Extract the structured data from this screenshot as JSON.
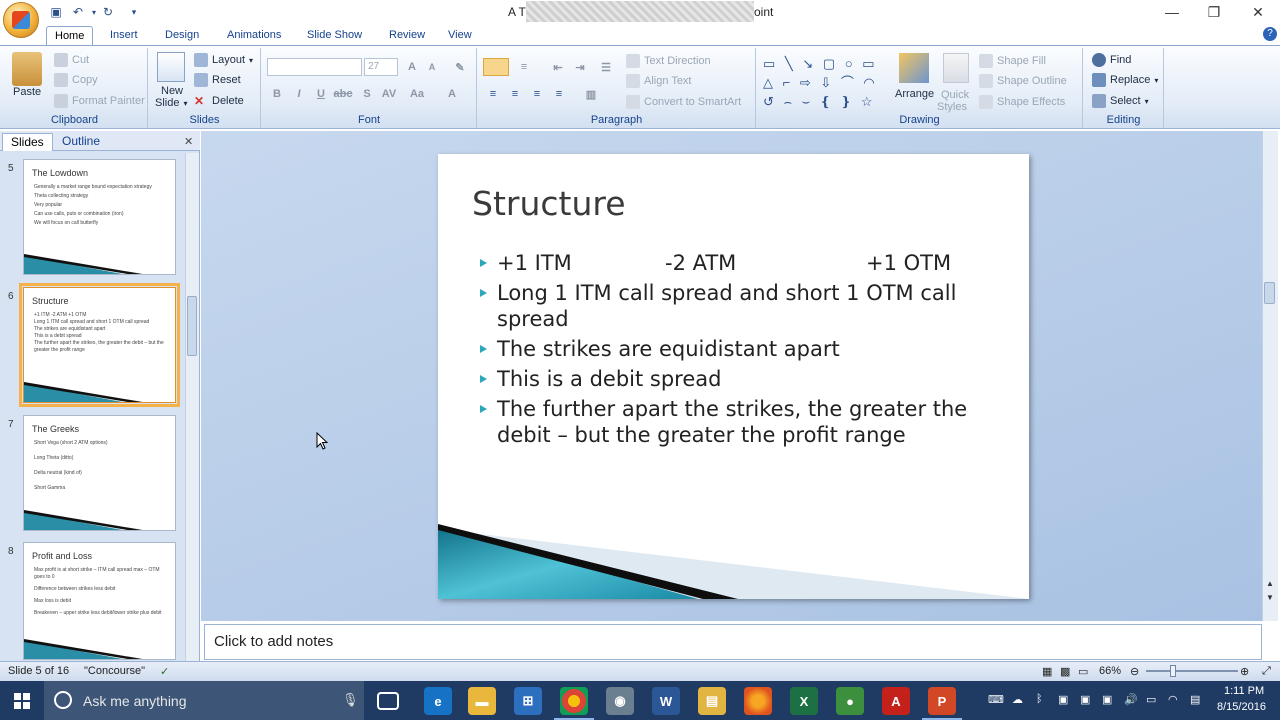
{
  "window": {
    "title": "A T",
    "title_suffix": "oint",
    "controls": [
      "minimize",
      "restore",
      "close"
    ]
  },
  "ribbon": {
    "tabs": [
      "Home",
      "Insert",
      "Design",
      "Animations",
      "Slide Show",
      "Review",
      "View"
    ],
    "active_tab": "Home",
    "clipboard": {
      "label": "Clipboard",
      "paste": "Paste",
      "cut": "Cut",
      "copy": "Copy",
      "format_painter": "Format Painter"
    },
    "slides": {
      "label": "Slides",
      "new_slide": "New",
      "new_slide_2": "Slide",
      "layout": "Layout",
      "reset": "Reset",
      "delete": "Delete"
    },
    "font": {
      "label": "Font",
      "size": "27"
    },
    "paragraph": {
      "label": "Paragraph",
      "text_direction": "Text Direction",
      "align_text": "Align Text",
      "convert": "Convert to SmartArt"
    },
    "drawing": {
      "label": "Drawing",
      "arrange": "Arrange",
      "quick_styles": "Quick",
      "quick_styles_2": "Styles",
      "shape_fill": "Shape Fill",
      "shape_outline": "Shape Outline",
      "shape_effects": "Shape Effects"
    },
    "editing": {
      "label": "Editing",
      "find": "Find",
      "replace": "Replace",
      "select": "Select"
    }
  },
  "panel": {
    "tabs": [
      "Slides",
      "Outline"
    ],
    "thumbnails": [
      {
        "num": "5",
        "title": "The Lowdown",
        "lines": [
          "Generally a market range bound expectation strategy",
          "Theta collecting strategy",
          "Very popular",
          "Can use calls, puts or combination (iron)",
          "We will focus on call butterfly"
        ]
      },
      {
        "num": "6",
        "title": "Structure",
        "lines": [
          "+1 ITM        -2 ATM        +1 OTM",
          "Long 1 ITM call spread and short 1 OTM call spread",
          "The strikes are equidistant apart",
          "This is a debit spread",
          "The further apart the strikes, the greater the debit – but the greater the profit range"
        ]
      },
      {
        "num": "7",
        "title": "The Greeks",
        "lines": [
          "Short Vega (short 2 ATM options)",
          "Long Theta (ditto)",
          "Delta neutral (kind of)",
          "Short Gamma"
        ]
      },
      {
        "num": "8",
        "title": "Profit and Loss",
        "lines": [
          "Max profit is at short strike – ITM call spread max – OTM goes to 0",
          "Difference between strikes less debit",
          "Max loss is debit",
          "Breakeven – upper strike less debit/lower strike plus debit"
        ]
      }
    ]
  },
  "slide": {
    "title": "Structure",
    "bullets": [
      {
        "cols": [
          "+1 ITM",
          "-2 ATM",
          "+1 OTM"
        ]
      },
      {
        "text": "Long 1 ITM call spread and short 1 OTM call spread"
      },
      {
        "text": "The strikes are equidistant apart"
      },
      {
        "text": "This is a debit spread"
      },
      {
        "text": "The further apart the strikes, the greater the debit – but the greater the profit range"
      }
    ]
  },
  "notes": {
    "placeholder": "Click to add notes"
  },
  "status": {
    "slide_info": "Slide 5 of 16",
    "theme": "\"Concourse\"",
    "zoom": "66%"
  },
  "taskbar": {
    "search_placeholder": "Ask me anything",
    "time": "1:11 PM",
    "date": "8/15/2016"
  },
  "colors": {
    "accent": "#2aa7b8",
    "ribbon_text": "#15428b",
    "taskbar": "#1f3b64"
  }
}
